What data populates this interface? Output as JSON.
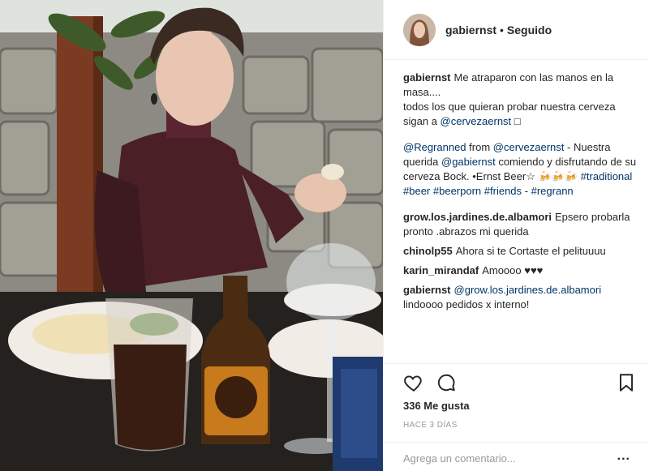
{
  "header": {
    "username": "gabiernst",
    "separator": "•",
    "follow_status": "Seguido"
  },
  "caption": {
    "username": "gabiernst",
    "line1": "Me atraparon con las manos en la masa....",
    "line2": "todos los que quieran probar nuestra cerveza sigan a",
    "mention": "@cervezaernst",
    "trailing": "□"
  },
  "regram": {
    "mention1": "@Regranned",
    "from": "from",
    "mention2": "@cervezaernst",
    "text1": "- Nuestra querida",
    "mention3": "@gabiernst",
    "text2": "comiendo y disfrutando de su cerveza Bock. •Ernst Beer☆ 🍻🍻🍻",
    "hashtags": [
      "#traditional",
      "#beer",
      "#beerporn",
      "#friends"
    ],
    "dash": "-",
    "hashtag_last": "#regrann"
  },
  "comments": [
    {
      "username": "grow.los.jardines.de.albamori",
      "text": "Epsero probarla pronto .abrazos mi querida"
    },
    {
      "username": "chinolp55",
      "text": "Ahora si te Cortaste el pelituuuu"
    },
    {
      "username": "karin_mirandaf",
      "text": "Amoooo ♥♥♥"
    },
    {
      "username": "gabiernst",
      "mention": "@grow.los.jardines.de.albamori",
      "text": "lindoooo pedidos x interno!"
    }
  ],
  "actions": {
    "likes": "336 Me gusta",
    "time": "HACE 3 DÍAS",
    "comment_placeholder": "Agrega un comentario...",
    "more": "..."
  },
  "icons": [
    "heart-icon",
    "comment-icon",
    "bookmark-icon"
  ],
  "colors": {
    "link": "#003569",
    "text": "#262626",
    "muted": "#999999",
    "border": "#efefef"
  }
}
